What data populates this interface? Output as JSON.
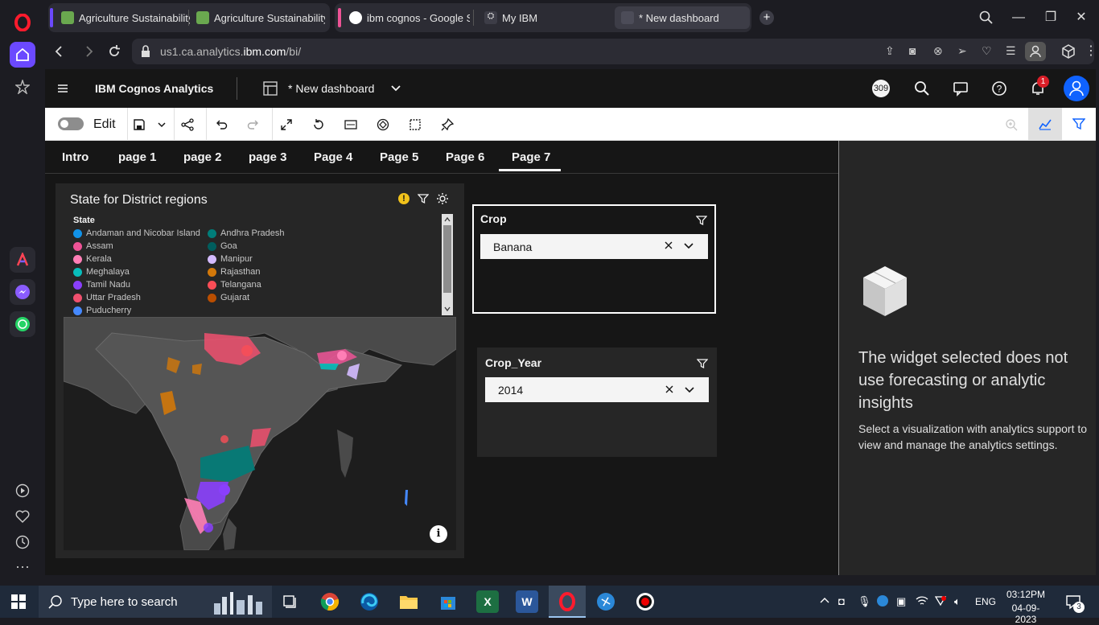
{
  "browser": {
    "tabs": [
      {
        "label": "Agriculture Sustainability"
      },
      {
        "label": "Agriculture Sustainability"
      },
      {
        "label": "ibm cognos - Google Sea"
      },
      {
        "label": "My IBM"
      },
      {
        "label": "* New dashboard"
      }
    ],
    "url_prefix": "us1.ca.analytics.",
    "url_domain": "ibm.com",
    "url_path": "/bi/"
  },
  "app": {
    "product": "IBM Cognos Analytics",
    "dashboard_title": "* New dashboard",
    "badge_count": "309",
    "notification_count": "1"
  },
  "toolbar": {
    "edit_label": "Edit"
  },
  "pages": [
    {
      "label": "Intro"
    },
    {
      "label": "page 1"
    },
    {
      "label": "page 2"
    },
    {
      "label": "page 3"
    },
    {
      "label": "Page 4"
    },
    {
      "label": "Page 5"
    },
    {
      "label": "Page 6"
    },
    {
      "label": "Page 7",
      "active": true
    }
  ],
  "map_widget": {
    "title": "State for District regions",
    "legend_title": "State",
    "legend": [
      {
        "label": "Andaman and Nicobar Island",
        "color": "#1192e8"
      },
      {
        "label": "Andhra Pradesh",
        "color": "#007d79"
      },
      {
        "label": "Assam",
        "color": "#ee5396"
      },
      {
        "label": "Goa",
        "color": "#005d5d"
      },
      {
        "label": "Kerala",
        "color": "#ff7eb6"
      },
      {
        "label": "Manipur",
        "color": "#d4bbff"
      },
      {
        "label": "Meghalaya",
        "color": "#08bdba"
      },
      {
        "label": "Rajasthan",
        "color": "#d2780a"
      },
      {
        "label": "Tamil Nadu",
        "color": "#8a3ffc"
      },
      {
        "label": "Telangana",
        "color": "#fa4d56"
      },
      {
        "label": "Uttar Pradesh",
        "color": "#f0506e"
      },
      {
        "label": "Gujarat",
        "color": "#ba4e00"
      },
      {
        "label": "Puducherry",
        "color": "#4589ff"
      }
    ]
  },
  "filters": [
    {
      "title": "Crop",
      "value": "Banana"
    },
    {
      "title": "Crop_Year",
      "value": "2014"
    }
  ],
  "right_panel": {
    "heading": "The widget selected does not use forecasting or analytic insights",
    "body": "Select a visualization with analytics support to view and manage the analytics settings."
  },
  "taskbar": {
    "search_placeholder": "Type here to search",
    "language": "ENG",
    "time": "03:12PM",
    "date": "04-09-2023",
    "notification_count": "3"
  }
}
